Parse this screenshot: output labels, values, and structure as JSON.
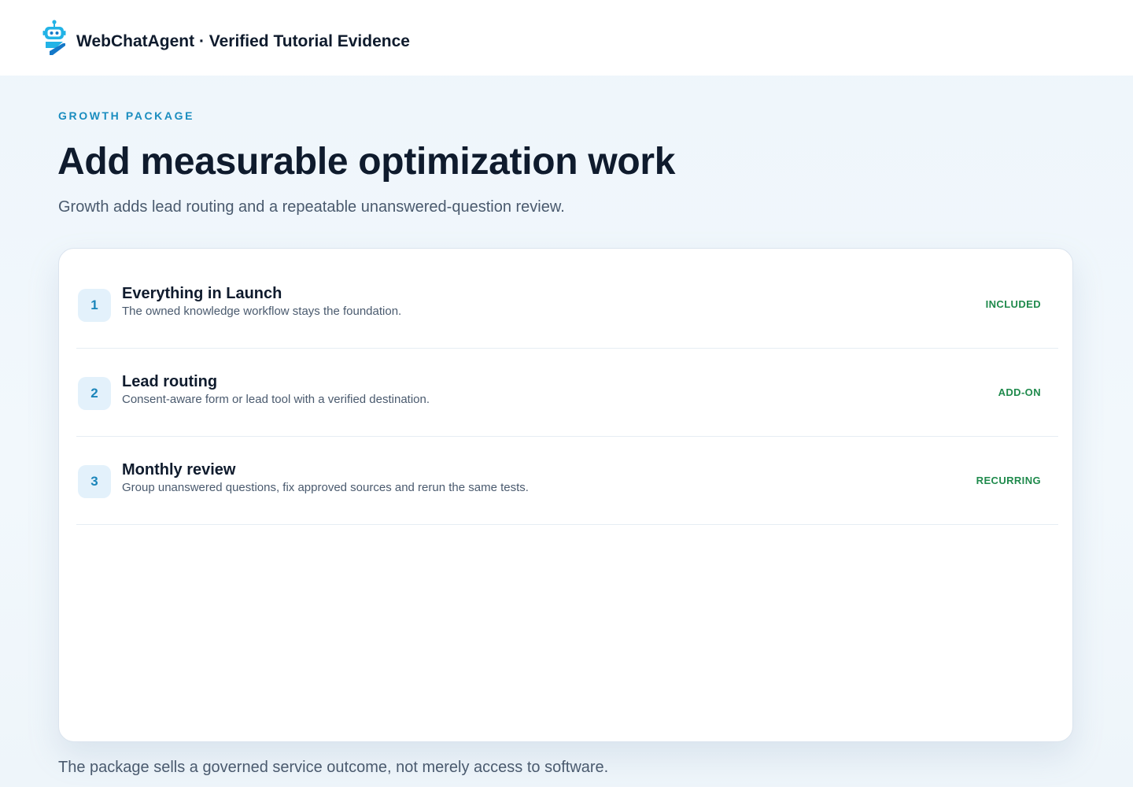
{
  "header": {
    "logo_icon": "robot-icon",
    "title": "WebChatAgent · Verified Tutorial Evidence"
  },
  "hero": {
    "eyebrow": "GROWTH PACKAGE",
    "headline": "Add measurable optimization work",
    "subhead": "Growth adds lead routing and a repeatable unanswered-question review."
  },
  "items": [
    {
      "number": "1",
      "title": "Everything in Launch",
      "description": "The owned knowledge workflow stays the foundation.",
      "tag": "INCLUDED"
    },
    {
      "number": "2",
      "title": "Lead routing",
      "description": "Consent-aware form or lead tool with a verified destination.",
      "tag": "ADD-ON"
    },
    {
      "number": "3",
      "title": "Monthly review",
      "description": "Group unanswered questions, fix approved sources and rerun the same tests.",
      "tag": "RECURRING"
    }
  ],
  "footer": {
    "note": "The package sells a governed service outcome, not merely access to software."
  },
  "colors": {
    "accent": "#1a8dbf",
    "tag_green": "#1f8a4c",
    "number_bg": "#e3f1fb"
  }
}
